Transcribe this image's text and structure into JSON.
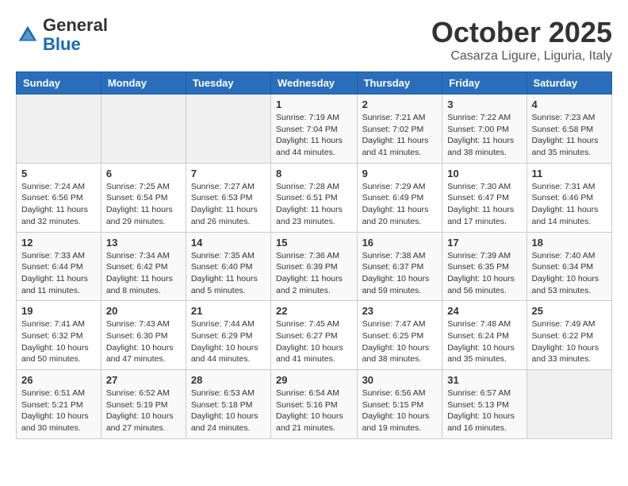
{
  "header": {
    "logo_general": "General",
    "logo_blue": "Blue",
    "month": "October 2025",
    "location": "Casarza Ligure, Liguria, Italy"
  },
  "weekdays": [
    "Sunday",
    "Monday",
    "Tuesday",
    "Wednesday",
    "Thursday",
    "Friday",
    "Saturday"
  ],
  "weeks": [
    [
      {
        "day": "",
        "info": ""
      },
      {
        "day": "",
        "info": ""
      },
      {
        "day": "",
        "info": ""
      },
      {
        "day": "1",
        "info": "Sunrise: 7:19 AM\nSunset: 7:04 PM\nDaylight: 11 hours and 44 minutes."
      },
      {
        "day": "2",
        "info": "Sunrise: 7:21 AM\nSunset: 7:02 PM\nDaylight: 11 hours and 41 minutes."
      },
      {
        "day": "3",
        "info": "Sunrise: 7:22 AM\nSunset: 7:00 PM\nDaylight: 11 hours and 38 minutes."
      },
      {
        "day": "4",
        "info": "Sunrise: 7:23 AM\nSunset: 6:58 PM\nDaylight: 11 hours and 35 minutes."
      }
    ],
    [
      {
        "day": "5",
        "info": "Sunrise: 7:24 AM\nSunset: 6:56 PM\nDaylight: 11 hours and 32 minutes."
      },
      {
        "day": "6",
        "info": "Sunrise: 7:25 AM\nSunset: 6:54 PM\nDaylight: 11 hours and 29 minutes."
      },
      {
        "day": "7",
        "info": "Sunrise: 7:27 AM\nSunset: 6:53 PM\nDaylight: 11 hours and 26 minutes."
      },
      {
        "day": "8",
        "info": "Sunrise: 7:28 AM\nSunset: 6:51 PM\nDaylight: 11 hours and 23 minutes."
      },
      {
        "day": "9",
        "info": "Sunrise: 7:29 AM\nSunset: 6:49 PM\nDaylight: 11 hours and 20 minutes."
      },
      {
        "day": "10",
        "info": "Sunrise: 7:30 AM\nSunset: 6:47 PM\nDaylight: 11 hours and 17 minutes."
      },
      {
        "day": "11",
        "info": "Sunrise: 7:31 AM\nSunset: 6:46 PM\nDaylight: 11 hours and 14 minutes."
      }
    ],
    [
      {
        "day": "12",
        "info": "Sunrise: 7:33 AM\nSunset: 6:44 PM\nDaylight: 11 hours and 11 minutes."
      },
      {
        "day": "13",
        "info": "Sunrise: 7:34 AM\nSunset: 6:42 PM\nDaylight: 11 hours and 8 minutes."
      },
      {
        "day": "14",
        "info": "Sunrise: 7:35 AM\nSunset: 6:40 PM\nDaylight: 11 hours and 5 minutes."
      },
      {
        "day": "15",
        "info": "Sunrise: 7:36 AM\nSunset: 6:39 PM\nDaylight: 11 hours and 2 minutes."
      },
      {
        "day": "16",
        "info": "Sunrise: 7:38 AM\nSunset: 6:37 PM\nDaylight: 10 hours and 59 minutes."
      },
      {
        "day": "17",
        "info": "Sunrise: 7:39 AM\nSunset: 6:35 PM\nDaylight: 10 hours and 56 minutes."
      },
      {
        "day": "18",
        "info": "Sunrise: 7:40 AM\nSunset: 6:34 PM\nDaylight: 10 hours and 53 minutes."
      }
    ],
    [
      {
        "day": "19",
        "info": "Sunrise: 7:41 AM\nSunset: 6:32 PM\nDaylight: 10 hours and 50 minutes."
      },
      {
        "day": "20",
        "info": "Sunrise: 7:43 AM\nSunset: 6:30 PM\nDaylight: 10 hours and 47 minutes."
      },
      {
        "day": "21",
        "info": "Sunrise: 7:44 AM\nSunset: 6:29 PM\nDaylight: 10 hours and 44 minutes."
      },
      {
        "day": "22",
        "info": "Sunrise: 7:45 AM\nSunset: 6:27 PM\nDaylight: 10 hours and 41 minutes."
      },
      {
        "day": "23",
        "info": "Sunrise: 7:47 AM\nSunset: 6:25 PM\nDaylight: 10 hours and 38 minutes."
      },
      {
        "day": "24",
        "info": "Sunrise: 7:48 AM\nSunset: 6:24 PM\nDaylight: 10 hours and 35 minutes."
      },
      {
        "day": "25",
        "info": "Sunrise: 7:49 AM\nSunset: 6:22 PM\nDaylight: 10 hours and 33 minutes."
      }
    ],
    [
      {
        "day": "26",
        "info": "Sunrise: 6:51 AM\nSunset: 5:21 PM\nDaylight: 10 hours and 30 minutes."
      },
      {
        "day": "27",
        "info": "Sunrise: 6:52 AM\nSunset: 5:19 PM\nDaylight: 10 hours and 27 minutes."
      },
      {
        "day": "28",
        "info": "Sunrise: 6:53 AM\nSunset: 5:18 PM\nDaylight: 10 hours and 24 minutes."
      },
      {
        "day": "29",
        "info": "Sunrise: 6:54 AM\nSunset: 5:16 PM\nDaylight: 10 hours and 21 minutes."
      },
      {
        "day": "30",
        "info": "Sunrise: 6:56 AM\nSunset: 5:15 PM\nDaylight: 10 hours and 19 minutes."
      },
      {
        "day": "31",
        "info": "Sunrise: 6:57 AM\nSunset: 5:13 PM\nDaylight: 10 hours and 16 minutes."
      },
      {
        "day": "",
        "info": ""
      }
    ]
  ]
}
